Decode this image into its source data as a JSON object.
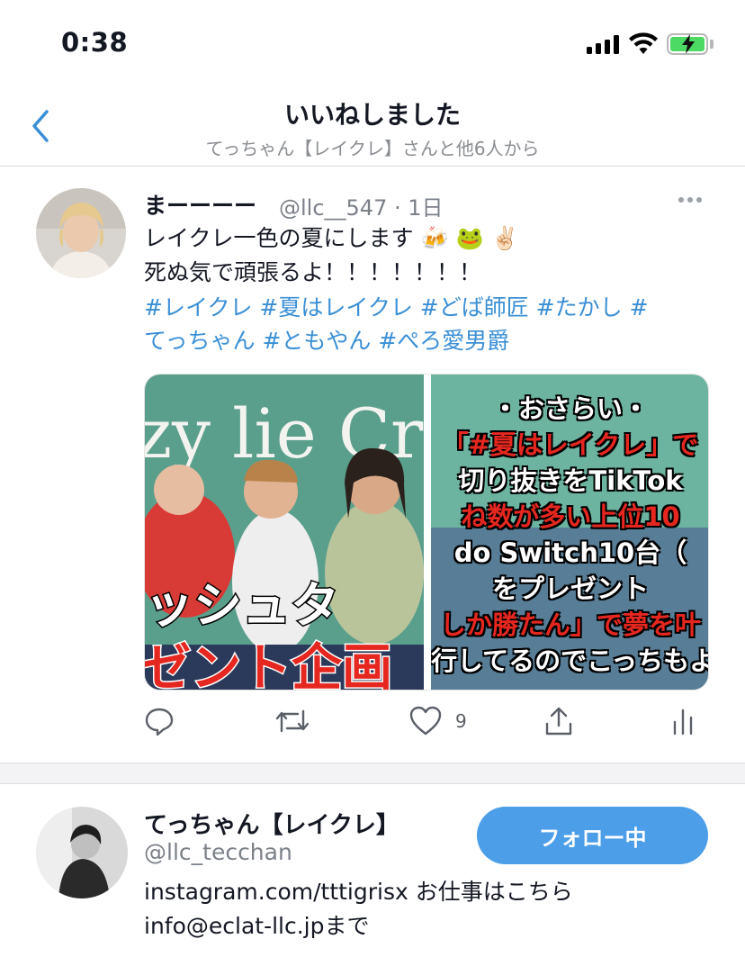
{
  "status_bar": {
    "time": "0:38",
    "icons": [
      "cellular-signal-icon",
      "wifi-icon",
      "battery-charging-icon"
    ],
    "battery_color": "#4cd964"
  },
  "nav": {
    "title": "いいねしました",
    "subtitle": "てっちゃん【レイクレ】さんと他6人から",
    "back_icon": "chevron-left-icon"
  },
  "tweet": {
    "author_name": "まーーーー",
    "handle_time": "@llc__547 · 1日",
    "line1": "レイクレ一色の夏にします 🍻 🐸 ✌🏻",
    "line2": "死ぬ気で頑張るよ！！！！！！！",
    "hashtags_line1": "#レイクレ #夏はレイクレ #どば師匠 #たかし #",
    "hashtags_line2": "てっちゃん #ともやん #ぺろ愛男爵",
    "media": {
      "left_text_top": "zy lie Cra",
      "left_text_mid": "ッシュタ",
      "left_text_bottom": "ゼント企画",
      "right_lines": [
        "・おさらい・",
        "「#夏はレイクレ」で",
        "切り抜きをTikTok",
        "ね数が多い上位10",
        "do Switch10台（",
        "をプレゼント",
        "しか勝たん」で夢を叶",
        "行してるのでこっちもよ"
      ]
    },
    "actions": {
      "reply_icon": "reply-icon",
      "retweet_icon": "retweet-icon",
      "like_icon": "heart-icon",
      "like_count": "9",
      "share_icon": "share-icon",
      "analytics_icon": "analytics-icon"
    },
    "hashtag_color": "#3b8fd6"
  },
  "user": {
    "name": "てっちゃん【レイクレ】",
    "handle": "@llc_tecchan",
    "bio_line1": "instagram.com/tttigrisx お仕事はこちら",
    "bio_line2": "info@eclat-llc.jpまで",
    "follow_label": "フォロー中",
    "button_color": "#4c9ee8"
  }
}
